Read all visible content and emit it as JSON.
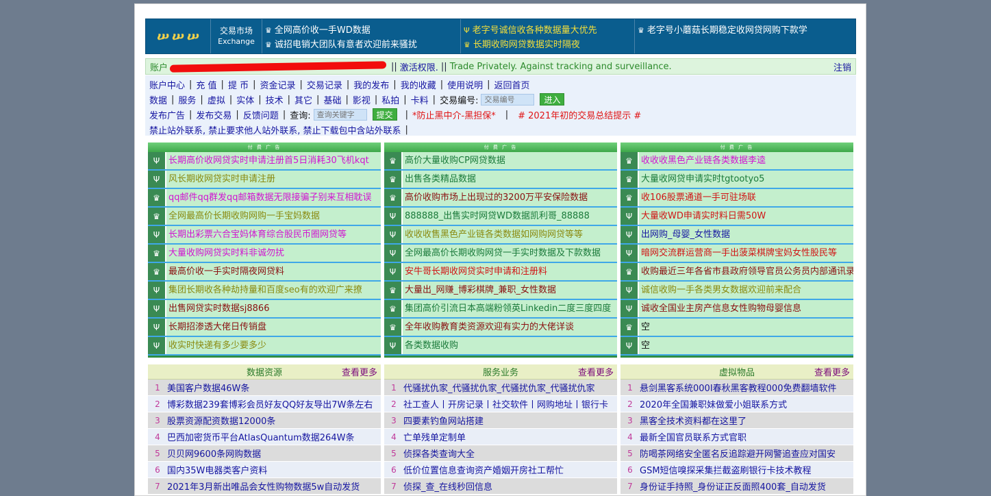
{
  "header": {
    "logo_glyphs": [
      "ሠ",
      "ሠ",
      "ሠ"
    ],
    "brand_cn": "交易市场",
    "brand_en": "Exchange",
    "col1": [
      {
        "icon": "crown-icon",
        "glyph": "♛",
        "text": "全网高价收一手WD数据"
      },
      {
        "icon": "crown-icon",
        "glyph": "♛",
        "text": "诚招电销大团队有意者欢迎前来骚扰"
      }
    ],
    "col2": [
      {
        "icon": "trident-icon",
        "glyph": "Ψ",
        "text": "老字号诚信收各种数据量大优先"
      },
      {
        "icon": "crown-icon",
        "glyph": "♛",
        "text": "长期收购网贷数据实时隔夜"
      }
    ],
    "col3": [
      {
        "icon": "crown-icon",
        "glyph": "♛",
        "text": "老字号小蘑菇长期稳定收网贷网购下款学"
      }
    ]
  },
  "account": {
    "label": "账户",
    "sep1": "||",
    "activate": "激活权限.",
    "sep2": "||",
    "motto": "Trade Privately. Against tracking and surveillance.",
    "logout": "注销"
  },
  "nav": {
    "row1": [
      "账户中心",
      "充 值",
      "提 币",
      "资金记录",
      "交易记录",
      "我的发布",
      "我的收藏",
      "使用说明",
      "返回首页"
    ],
    "row2": [
      "数据",
      "服务",
      "虚拟",
      "实体",
      "技术",
      "其它",
      "基础",
      "影视",
      "私拍",
      "卡料"
    ],
    "trade_no_label": "交易编号:",
    "trade_no_placeholder": "交易编号",
    "enter_btn": "进入",
    "row3": [
      "发布广告",
      "发布交易",
      "反馈问题"
    ],
    "query_label": "查询:",
    "query_placeholder": "查询关键字",
    "submit_btn": "提交",
    "warning1": "*防止黑中介-黑担保*",
    "warning2": "# 2021年初的交易总结提示 #",
    "row4": "禁止站外联系, 禁止要求他人站外联系, 禁止下载包中含站外联系"
  },
  "ads": {
    "head_label": "付 费 广 告",
    "columns": [
      [
        {
          "glyph": "Ψ",
          "icon": "trident-icon",
          "text": "长期高价收网贷实时申请注册首5日消耗30飞机kqt",
          "color": "#d114d1"
        },
        {
          "glyph": "Ψ",
          "icon": "trident-icon",
          "text": "风长期收网贷实时申请注册",
          "color": "#8a8a10"
        },
        {
          "glyph": "♛",
          "icon": "crown-icon",
          "text": "qq邮件qq群发qq邮箱数据无限接骗子别来互相耽误",
          "color": "#d114d1"
        },
        {
          "glyph": "♛",
          "icon": "crown-icon",
          "text": "全网最高价长期收购网购一手宝妈数据",
          "color": "#8a8a10"
        },
        {
          "glyph": "Ψ",
          "icon": "trident-icon",
          "text": "长期出彩票六合宝妈体育综合股民币圈网贷等",
          "color": "#d114d1"
        },
        {
          "glyph": "♛",
          "icon": "crown-icon",
          "text": "大量收购网贷实时料非诚勿扰",
          "color": "#d114d1"
        },
        {
          "glyph": "♛",
          "icon": "crown-icon",
          "text": "最高价收一手实时隔夜网贷料",
          "color": "#8a1010"
        },
        {
          "glyph": "Ψ",
          "icon": "trident-icon",
          "text": "集团长期收各种劫持量和百度seo有的欢迎广来撩",
          "color": "#8a8a10"
        },
        {
          "glyph": "Ψ",
          "icon": "trident-icon",
          "text": "出售网贷实时数据sj8866",
          "color": "#8a1010"
        },
        {
          "glyph": "Ψ",
          "icon": "trident-icon",
          "text": "长期招渗透大佬日传销盘",
          "color": "#8a1010"
        },
        {
          "glyph": "Ψ",
          "icon": "trident-icon",
          "text": "收实时快递有多少要多少",
          "color": "#8a8a10"
        }
      ],
      [
        {
          "glyph": "♛",
          "icon": "crown-icon",
          "text": "高价大量收购CP网贷数据",
          "color": "#1a7a3a"
        },
        {
          "glyph": "♛",
          "icon": "crown-icon",
          "text": "出售各类精品数据",
          "color": "#1a7a3a"
        },
        {
          "glyph": "♛",
          "icon": "crown-icon",
          "text": "高价收购市场上出现过的3200万平安保险数据",
          "color": "#8a1010"
        },
        {
          "glyph": "Ψ",
          "icon": "trident-icon",
          "text": "888888_出售实时网贷WD数据凯利哥_88888",
          "color": "#1a7a3a"
        },
        {
          "glyph": "Ψ",
          "icon": "trident-icon",
          "text": "收收收售黑色产业链各类数据如网购网贷等等",
          "color": "#8a8a10"
        },
        {
          "glyph": "Ψ",
          "icon": "trident-icon",
          "text": "全网最高价长期收购网贷一手实时数据及下款数据",
          "color": "#1a7a3a"
        },
        {
          "glyph": "Ψ",
          "icon": "trident-icon",
          "text": "安牛哥长期收网贷实时申请和注册料",
          "color": "#d11414"
        },
        {
          "glyph": "♛",
          "icon": "crown-icon",
          "text": "大量出_网赚_博彩棋牌_兼职_女性数据",
          "color": "#8a1010"
        },
        {
          "glyph": "♛",
          "icon": "crown-icon",
          "text": "集团高价引流日本高端粉领英Linkedin二度三度四度",
          "color": "#1a7a3a"
        },
        {
          "glyph": "♛",
          "icon": "crown-icon",
          "text": "全年收购教育类资源欢迎有实力的大佬详谈",
          "color": "#8a1010"
        },
        {
          "glyph": "Ψ",
          "icon": "trident-icon",
          "text": "各类数据收购",
          "color": "#1a7a3a"
        }
      ],
      [
        {
          "glyph": "♛",
          "icon": "crown-icon",
          "text": "收收收黑色产业链各类数据李逵",
          "color": "#d114d1"
        },
        {
          "glyph": "♛",
          "icon": "crown-icon",
          "text": "大量收网贷申请实时tgtootyo5",
          "color": "#1a7a3a"
        },
        {
          "glyph": "♛",
          "icon": "crown-icon",
          "text": "收106股票通道一手可驻场联",
          "color": "#d11414"
        },
        {
          "glyph": "Ψ",
          "icon": "trident-icon",
          "text": "大量收WD申请实时料日需50W",
          "color": "#d11414"
        },
        {
          "glyph": "Ψ",
          "icon": "trident-icon",
          "text": "出网购_母婴_女性数据",
          "color": "#1515a0"
        },
        {
          "glyph": "Ψ",
          "icon": "trident-icon",
          "text": "暗网交流群运营商一手出菠菜棋牌宝妈女性股民等",
          "color": "#d11414"
        },
        {
          "glyph": "♛",
          "icon": "crown-icon",
          "text": "收购最近三年各省市县政府领导官员公务员内部通讯录",
          "color": "#8a1010"
        },
        {
          "glyph": "Ψ",
          "icon": "trident-icon",
          "text": "诚信收购一手各类男女数据欢迎前来配合",
          "color": "#8a8a10"
        },
        {
          "glyph": "Ψ",
          "icon": "trident-icon",
          "text": "诚收全国业主房产信息女性购物母婴信息",
          "color": "#8a1010"
        },
        {
          "glyph": "♛",
          "icon": "crown-icon",
          "text": "空",
          "color": "#111111"
        },
        {
          "glyph": "Ψ",
          "icon": "trident-icon",
          "text": "空",
          "color": "#111111"
        }
      ]
    ]
  },
  "lists": [
    {
      "title": "数据资源",
      "more": "查看更多",
      "items": [
        "美国客户数据46W条",
        "博彩数据239套博彩会员好友QQ好友导出7W条左右",
        "股票资源配资数据12000条",
        "巴西加密货币平台AtlasQuantum数据264W条",
        "贝贝网9600条网购数据",
        "国内35W电器类客户资料",
        "2021年3月新出唯品会女性购物数据5w自动发货"
      ]
    },
    {
      "title": "服务业务",
      "more": "查看更多",
      "items": [
        "代骚扰仇家_代骚扰仇家_代骚扰仇家_代骚扰仇家",
        "社工查人丨开房记录丨社交软件丨网购地址丨银行卡",
        "四要素钓鱼网站搭建",
        "亡单残单定制单",
        "侦探各类查询大全",
        "低价位置信息查询资产婚姻开房社工帮忙",
        "侦探_查_在线秒回信息"
      ]
    },
    {
      "title": "虚拟物品",
      "more": "查看更多",
      "items": [
        "悬剑黑客系统000I春秋黑客教程000免费翻墙软件",
        "2020年全国兼职妹做爱小姐联系方式",
        "黑客全技术资料都在这里了",
        "最新全国官员联系方式官职",
        "防喝茶网络安全匿名反追踪避开网警追查应对国安",
        "GSM短信嗅探采集拦截盗刷银行卡技术教程",
        "身份证手持照_身份证正反面照400套_自动发货"
      ]
    }
  ]
}
